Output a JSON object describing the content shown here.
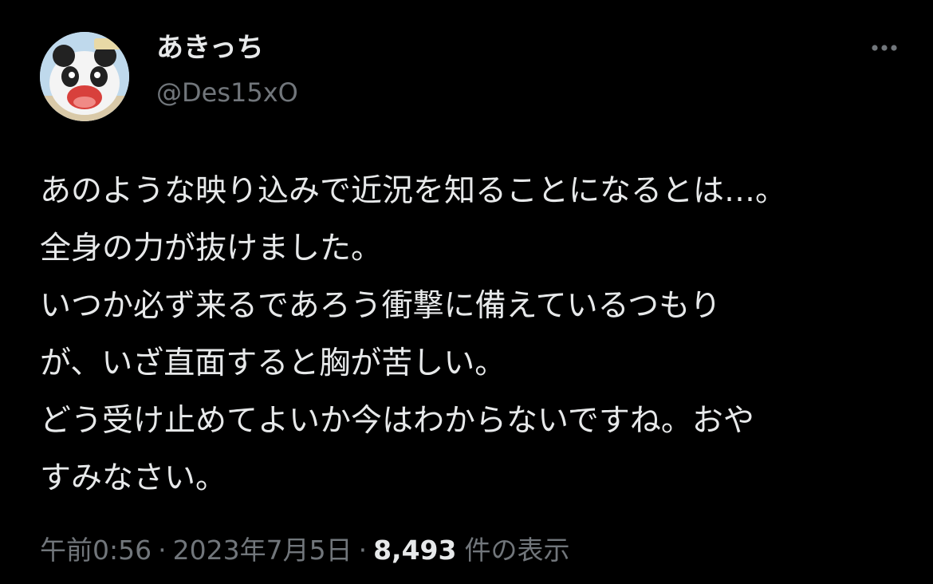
{
  "author": {
    "display_name": "あきっち",
    "handle": "@Des15xO"
  },
  "tweet": {
    "lines": [
      "あのような映り込みで近況を知ることになるとは…。",
      "全身の力が抜けました。",
      "いつか必ず来るであろう衝撃に備えているつもり",
      "が、いざ直面すると胸が苦しい。",
      "どう受け止めてよいか今はわからないですね。おや",
      "すみなさい。"
    ]
  },
  "meta": {
    "time": "午前0:56",
    "separator": "·",
    "date": "2023年7月5日",
    "views_count": "8,493",
    "views_label": "件の表示"
  },
  "icons": {
    "more": "more-horizontal-icon",
    "avatar": "panda-avatar"
  },
  "colors": {
    "background": "#000000",
    "primary_text": "#e7e9ea",
    "secondary_text": "#71767b"
  }
}
